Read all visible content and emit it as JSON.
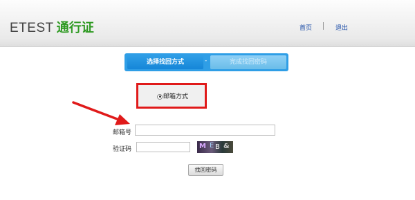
{
  "header": {
    "brand": "ETEST",
    "brand_sub": "通行证",
    "nav_home": "首页",
    "nav_logout": "退出"
  },
  "steps": [
    {
      "label": "选择找回方式",
      "active": true
    },
    {
      "label": "完成找回密码",
      "active": false
    }
  ],
  "step_separator": "-",
  "method": {
    "label": "邮箱方式",
    "selected": true
  },
  "form": {
    "email_label": "邮箱号",
    "email_value": "",
    "code_label": "验证码",
    "code_value": "",
    "captcha_text": "M E B",
    "submit_label": "找回密码"
  },
  "colors": {
    "accent_green": "#2f9a23",
    "step_blue": "#2f9ee6",
    "highlight_red": "#e01a1a",
    "link_blue": "#1f4fa8"
  }
}
